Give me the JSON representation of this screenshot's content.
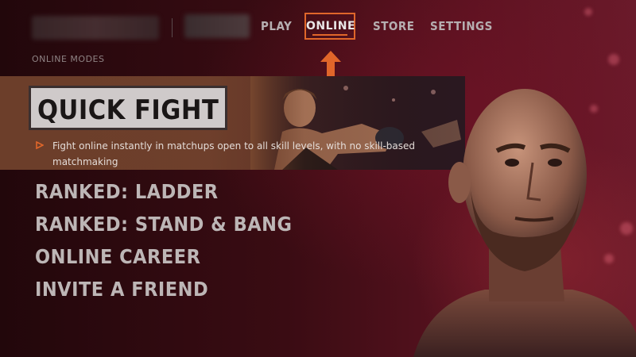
{
  "header": {
    "nav": [
      {
        "label": "PLAY",
        "selected": false
      },
      {
        "label": "ONLINE",
        "selected": true
      },
      {
        "label": "STORE",
        "selected": false
      },
      {
        "label": "SETTINGS",
        "selected": false
      }
    ]
  },
  "section_label": "ONLINE MODES",
  "featured": {
    "title": "QUICK FIGHT",
    "description": "Fight online instantly in matchups open to all skill levels, with no skill-based matchmaking"
  },
  "modes": [
    {
      "label": "RANKED: LADDER"
    },
    {
      "label": "RANKED: STAND & BANG"
    },
    {
      "label": "ONLINE CAREER"
    },
    {
      "label": "INVITE A FRIEND"
    }
  ],
  "icons": {
    "arrow": "arrow-up-icon",
    "bullet": "play-triangle-icon"
  },
  "colors": {
    "accent": "#e0662a",
    "text": "#bdb6b6",
    "card_bg": "#76462e"
  }
}
